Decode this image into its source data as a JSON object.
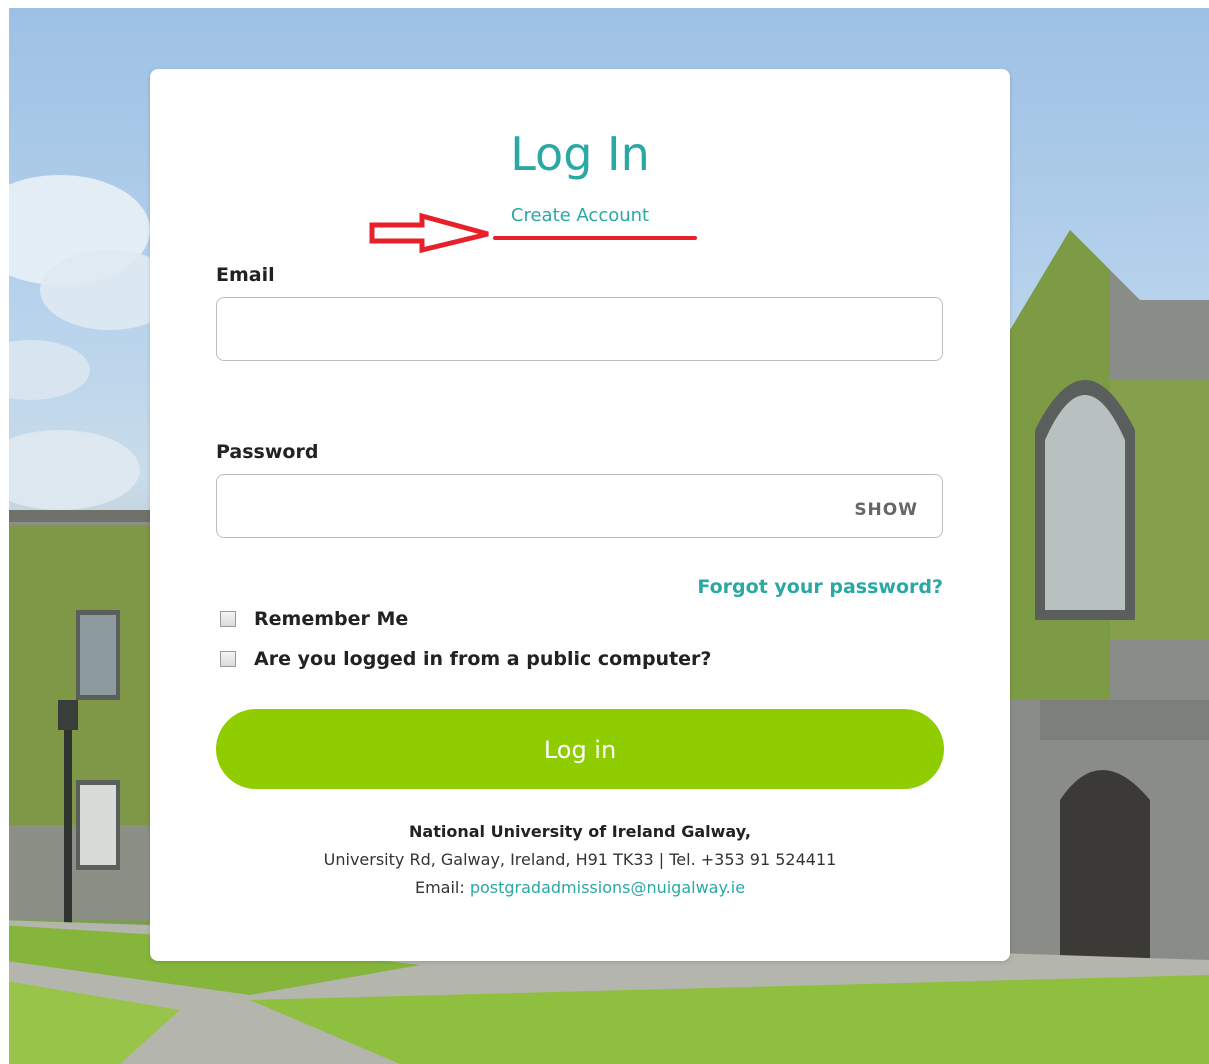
{
  "page": {
    "title": "Log In",
    "create_account_label": "Create Account"
  },
  "form": {
    "email_label": "Email",
    "email_value": "",
    "password_label": "Password",
    "password_value": "",
    "show_label": "SHOW",
    "forgot_label": "Forgot your password?",
    "remember_label": "Remember Me",
    "remember_checked": false,
    "public_label": "Are you logged in from a public computer?",
    "public_checked": false,
    "submit_label": "Log in"
  },
  "footer": {
    "org_name": "National University of Ireland Galway,",
    "address": "University Rd, Galway, Ireland, H91 TK33 | Tel. +353 91 524411",
    "email_prefix": "Email: ",
    "email": "postgradadmissions@nuigalway.ie"
  },
  "colors": {
    "accent": "#2aa8a4",
    "button": "#8fcc00",
    "annotation": "#e8202a"
  }
}
